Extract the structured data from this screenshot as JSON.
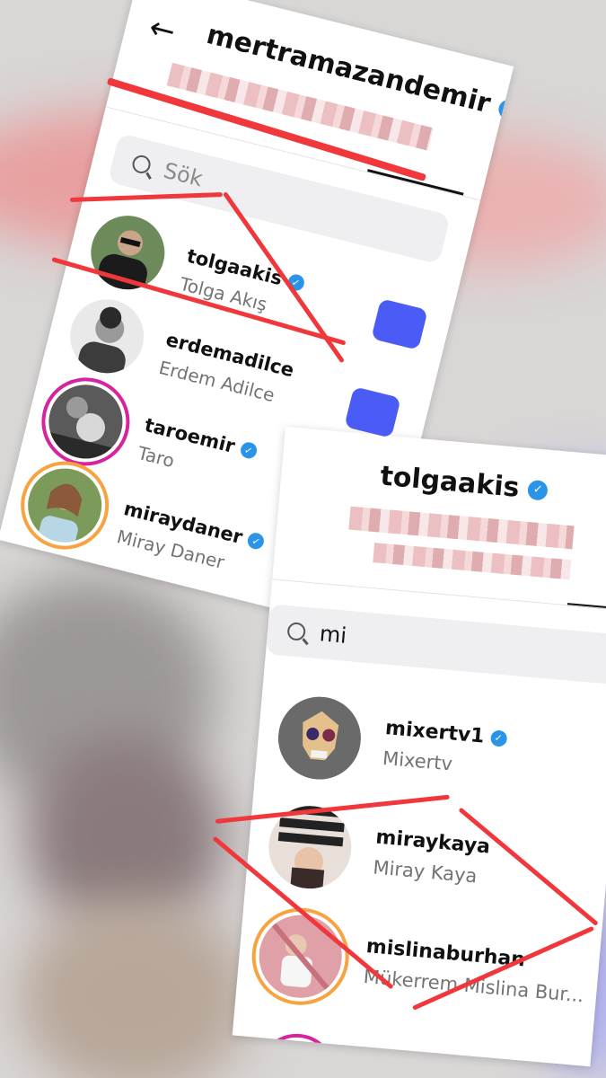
{
  "screen1": {
    "back_icon": "back-arrow-icon",
    "account_title": "mertramazandemir",
    "search_placeholder": "Sök",
    "results": [
      {
        "username": "tolgaakis",
        "full_name": "Tolga Akış",
        "verified": true
      },
      {
        "username": "erdemadilce",
        "full_name": "Erdem Adilce",
        "verified": false
      },
      {
        "username": "taroemir",
        "full_name": "Taro",
        "verified": true
      },
      {
        "username": "miraydaner",
        "full_name": "Miray Daner",
        "verified": true
      }
    ]
  },
  "screen2": {
    "account_title": "tolgaakis",
    "search_value": "mi",
    "results": [
      {
        "username": "mixertv1",
        "full_name": "Mixertv",
        "verified": true
      },
      {
        "username": "miraykaya",
        "full_name": "Miray Kaya",
        "verified": false
      },
      {
        "username": "mislinaburhan",
        "full_name": "Mükerrem Mislina Bur...",
        "verified": false
      }
    ]
  },
  "colors": {
    "verified_blue": "#2a95e8",
    "follow_button": "#4a5cf5",
    "annotation_red": "#f0373c",
    "story_ring": "#d6249f"
  }
}
